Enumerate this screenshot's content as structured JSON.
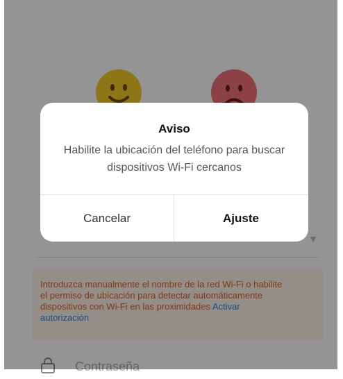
{
  "dialog": {
    "title": "Aviso",
    "message": "Habilite la ubicación del teléfono para buscar dispositivos Wi-Fi cercanos",
    "cancel_label": "Cancelar",
    "confirm_label": "Ajuste"
  },
  "notice": {
    "text": "Introduzca manualmente el nombre de la red Wi-Fi o habilite el permiso de ubicación para detectar automáticamente dispositivos con Wi-Fi en las proximidades ",
    "link_label": "Activar autorización"
  },
  "password": {
    "placeholder": "Contraseña",
    "icon": "lock-icon"
  },
  "colors": {
    "happy_emoji": "#f5cc2a",
    "sad_emoji": "#f2707a",
    "notice_text": "#e2601e",
    "link": "#2f80e6"
  }
}
